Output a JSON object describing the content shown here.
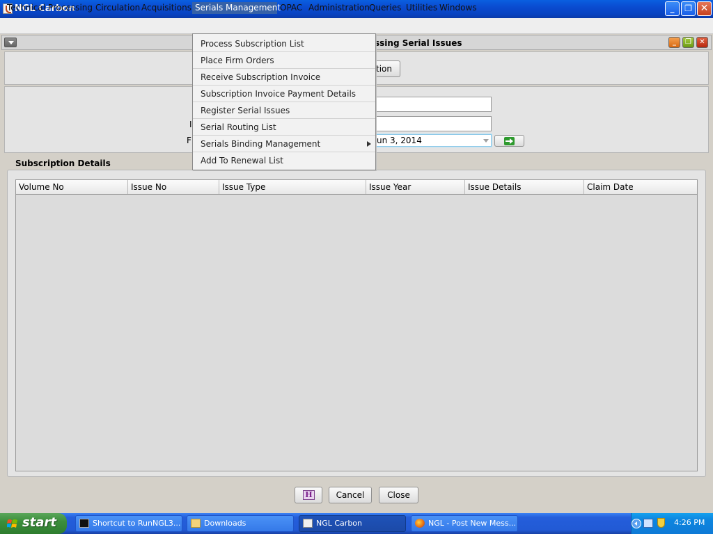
{
  "window": {
    "title": "NGL Carbon"
  },
  "menubar": {
    "items": [
      "Technical Processing",
      "Circulation",
      "Acquisitions",
      "Serials Management",
      "OPAC",
      "Administration",
      "Queries",
      "Utilities",
      "Windows"
    ],
    "active": "Serials Management"
  },
  "serials_menu": {
    "items": [
      "Process Subscription List",
      "Place Firm Orders",
      "Receive Subscription Invoice",
      "Subscription Invoice Payment Details",
      "Register Serial Issues",
      "Serial Routing List",
      "Serials Binding Management",
      "Add To Renewal List"
    ],
    "submenu_item": "Serials Binding Management"
  },
  "internal_frame": {
    "title_visible": "ssing Serial Issues",
    "partial_button": "ption",
    "partial_label_1": "I",
    "partial_label_2": "F",
    "date_value": "un 3, 2014"
  },
  "subscription_details": {
    "heading": "Subscription Details",
    "columns": [
      "Volume No",
      "Issue No",
      "Issue Type",
      "Issue Year",
      "Issue Details",
      "Claim Date"
    ],
    "rows": []
  },
  "footer": {
    "help_glyph": "H",
    "cancel_label": "Cancel",
    "close_label": "Close"
  },
  "taskbar": {
    "start_label": "start",
    "tasks": [
      {
        "label": "Shortcut to RunNGL3...",
        "icon": "cmd-icon"
      },
      {
        "label": "Downloads",
        "icon": "folder-icon"
      },
      {
        "label": "NGL Carbon",
        "icon": "java-icon"
      },
      {
        "label": "NGL - Post New Mess...",
        "icon": "firefox-icon"
      }
    ],
    "clock": "4:26 PM"
  },
  "colors": {
    "menu_highlight": "#3561a8",
    "titlebar": "#0a4bd0",
    "taskbar": "#245edb",
    "start": "#3b8e3b"
  }
}
